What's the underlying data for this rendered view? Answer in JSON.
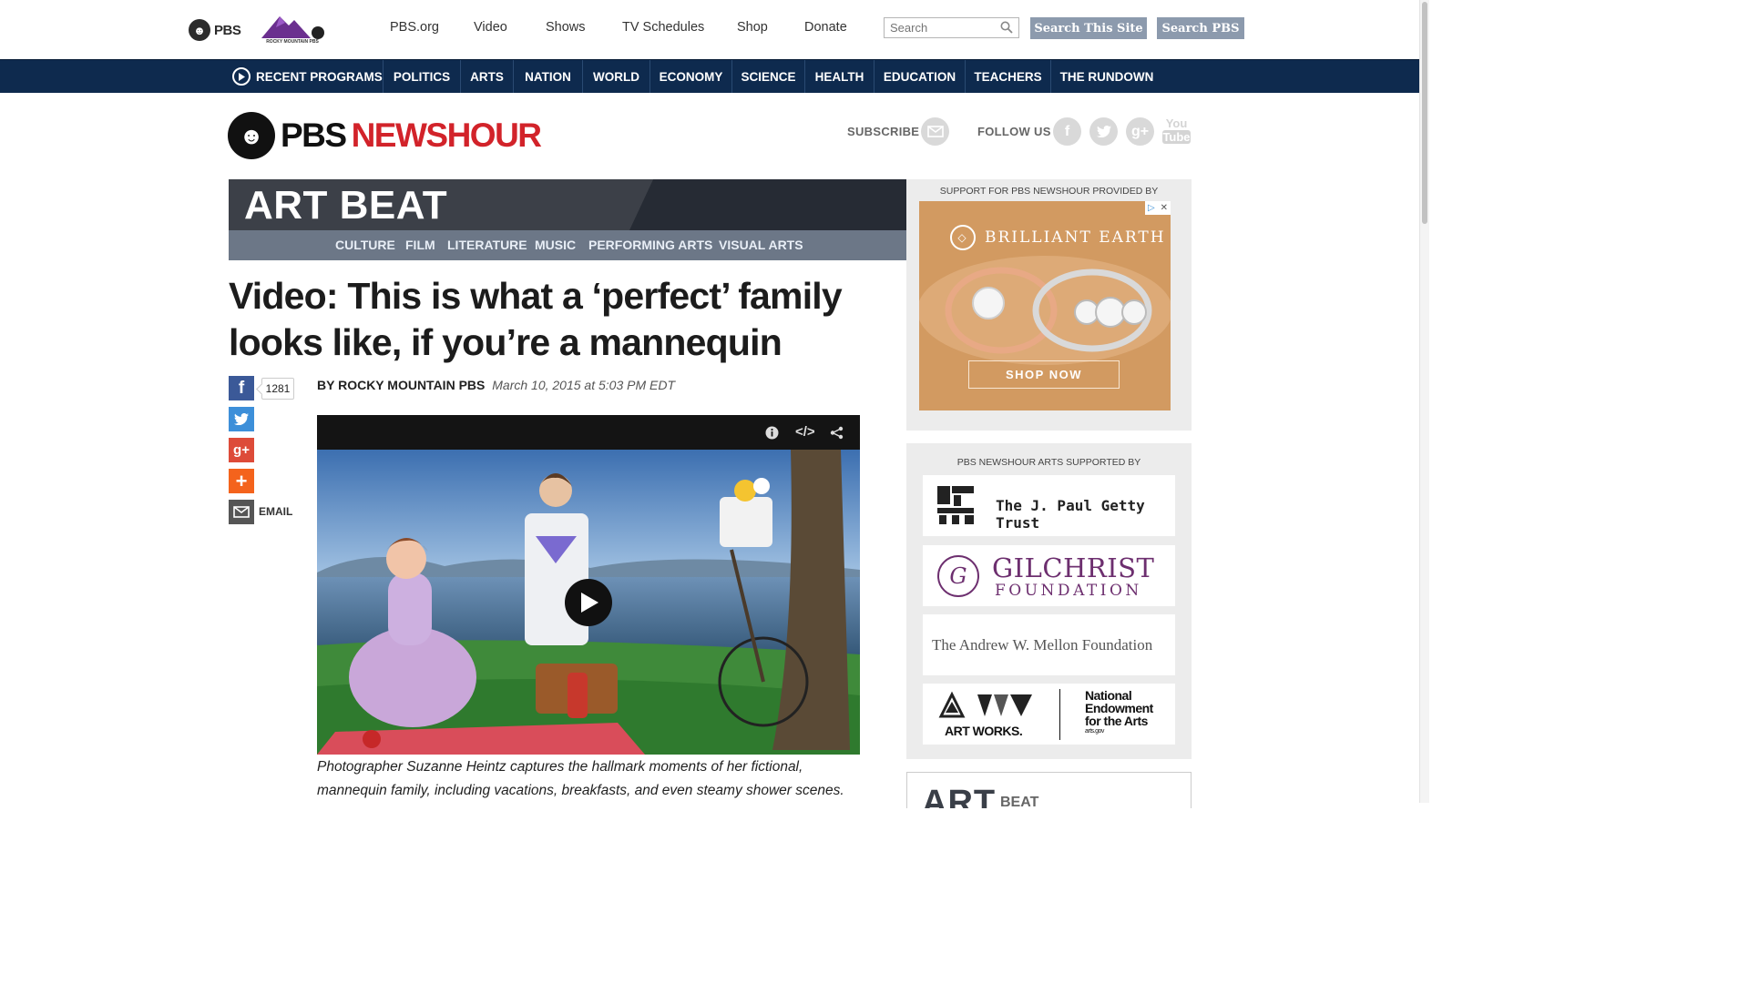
{
  "top": {
    "pbs_label": "PBS",
    "station_label": "ROCKY MOUNTAIN PBS",
    "links": [
      "PBS.org",
      "Video",
      "Shows",
      "TV Schedules",
      "Shop",
      "Donate"
    ],
    "search_placeholder": "Search",
    "search_site_label": "Search This Site",
    "search_pbs_label": "Search PBS"
  },
  "nav": {
    "items": [
      "RECENT PROGRAMS",
      "POLITICS",
      "ARTS",
      "NATION",
      "WORLD",
      "ECONOMY",
      "SCIENCE",
      "HEALTH",
      "EDUCATION",
      "TEACHERS",
      "THE RUNDOWN"
    ]
  },
  "header": {
    "logo_pbs": "PBS",
    "logo_newshour": "NEWSHOUR",
    "subscribe_label": "SUBSCRIBE",
    "follow_label": "FOLLOW US",
    "youtube_label_1": "You",
    "youtube_label_2": "Tube"
  },
  "section": {
    "title": "ART BEAT",
    "categories": [
      "CULTURE",
      "FILM",
      "LITERATURE",
      "MUSIC",
      "PERFORMING ARTS",
      "VISUAL ARTS"
    ]
  },
  "article": {
    "headline": "Video: This is what a ‘perfect’ family looks like, if you’re a mannequin",
    "byline": "BY ROCKY MOUNTAIN PBS",
    "date": "March 10, 2015 at 5:03 PM EDT",
    "share_count": "1281",
    "email_label": "EMAIL",
    "caption": "Photographer Suzanne Heintz captures the hallmark moments of her fictional, mannequin family, including vacations, breakfasts, and even steamy shower scenes."
  },
  "sidebar": {
    "ad_label": "SUPPORT FOR PBS NEWSHOUR PROVIDED BY",
    "ad_brand": "BRILLIANT EARTH",
    "ad_button": "SHOP NOW",
    "sponsors_label": "PBS NEWSHOUR ARTS SUPPORTED BY",
    "sponsors": {
      "getty": "The J. Paul Getty Trust",
      "gilchrist_1": "GILCHRIST",
      "gilchrist_2": "FOUNDATION",
      "mellon": "The Andrew W. Mellon Foundation",
      "artworks": "ART WORKS.",
      "nea_1": "National",
      "nea_2": "Endowment",
      "nea_3": "for the Arts",
      "nea_url": "arts.gov"
    },
    "footer_title": "ART",
    "footer_sub": "BEAT"
  },
  "colors": {
    "nav_bg": "#0e2a4e",
    "newshour_red": "#d2232a",
    "artbeat_dark": "#3c4048",
    "artbeat_sub": "#6c7787",
    "search_btn": "#8c9aad"
  }
}
